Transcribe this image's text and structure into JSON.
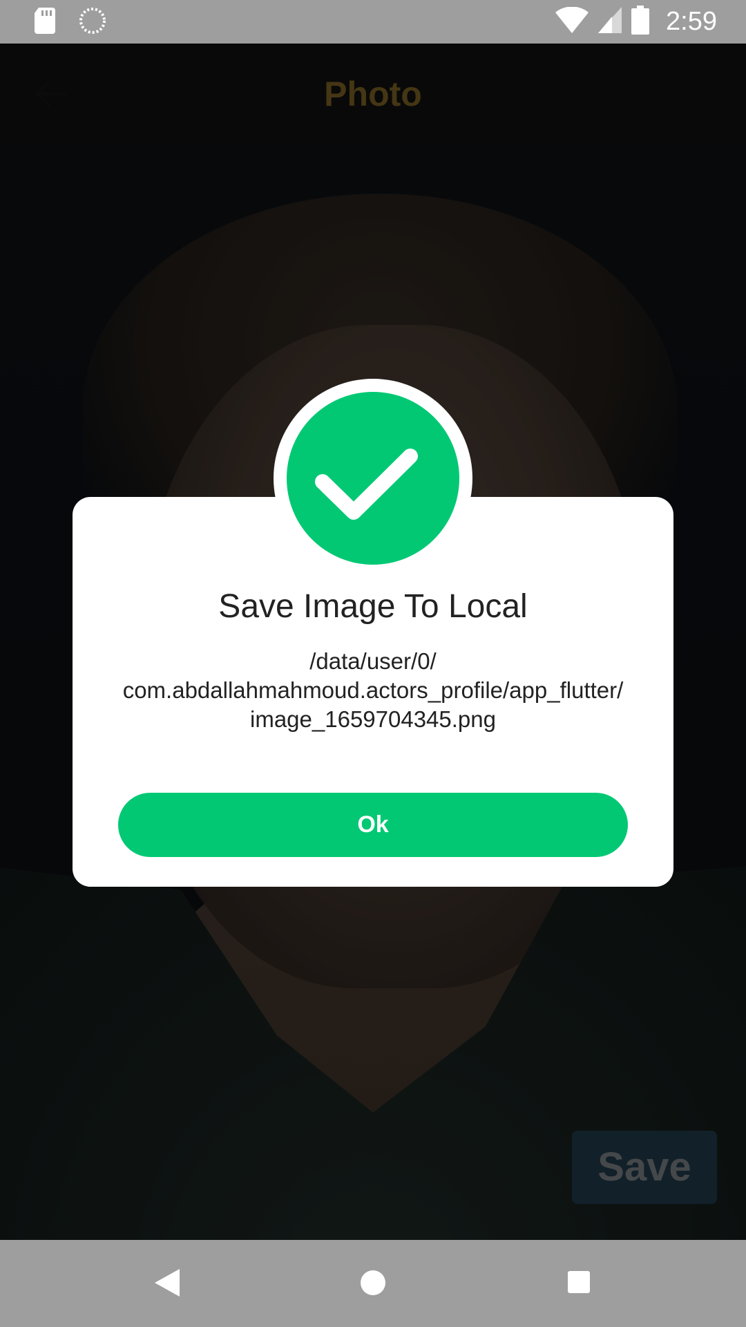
{
  "status_bar": {
    "time": "2:59",
    "icons": [
      "sd-card-icon",
      "sync-icon",
      "wifi-icon",
      "signal-icon",
      "battery-icon"
    ]
  },
  "app_bar": {
    "title": "Photo",
    "back_icon": "arrow-back-icon"
  },
  "photo": {
    "description_icon": "portrait-photo"
  },
  "save_button": {
    "label": "Save"
  },
  "dialog": {
    "icon": "check-icon",
    "title": "Save Image To Local",
    "message_lines": [
      "/data/user/0/",
      "com.abdallahmahmoud.actors_profile/app_flutter/",
      "image_1659704345.png"
    ],
    "ok_label": "Ok"
  },
  "nav_bar": {
    "icons": [
      "nav-back-icon",
      "nav-home-icon",
      "nav-recents-icon"
    ]
  },
  "colors": {
    "accent_green": "#02c874",
    "title_gold": "#6b5420",
    "save_button_bg": "#1d3240",
    "system_bar": "#9e9e9e"
  }
}
